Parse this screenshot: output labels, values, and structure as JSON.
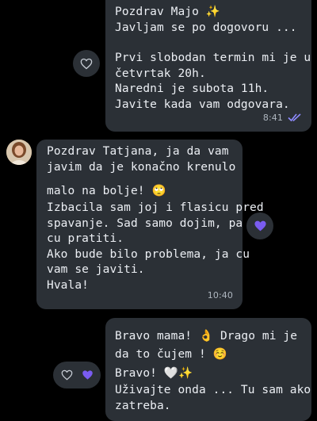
{
  "colors": {
    "background": "#000000",
    "bubble": "#2B3036",
    "text": "#ECEFF4",
    "meta": "#AEB6BF",
    "accent_purple": "#7A5CF0",
    "read_ticks": "#8E8BFF"
  },
  "messages": [
    {
      "direction": "outgoing",
      "lines": [
        "Pozdrav Majo ✨",
        "Javljam se po dogovoru ...",
        "",
        "Prvi slobodan termin mi je u",
        "četvrtak 20h.",
        "Naredni je subota 11h.",
        "Javite kada vam odgovara."
      ],
      "time": "8:41",
      "status_icon": "double-check-icon"
    },
    {
      "direction": "incoming",
      "lines": [
        "Pozdrav Tatjana, ja da vam",
        "javim da je konačno krenulo",
        "malo na bolje! 🙄",
        "Izbacila sam joj i flasicu pred",
        "spavanje. Sad samo dojim, pa",
        "cu pratiti.",
        "Ako bude bilo problema, ja cu",
        "vam se javiti.",
        "Hvala!"
      ],
      "time": "10:40"
    },
    {
      "direction": "outgoing",
      "lines": [
        "Bravo mama! 👌 Drago mi je",
        "da to čujem ! ☺️",
        "Bravo! 🤍✨",
        "Uživajte onda ... Tu sam ako",
        "zatreba."
      ]
    }
  ]
}
